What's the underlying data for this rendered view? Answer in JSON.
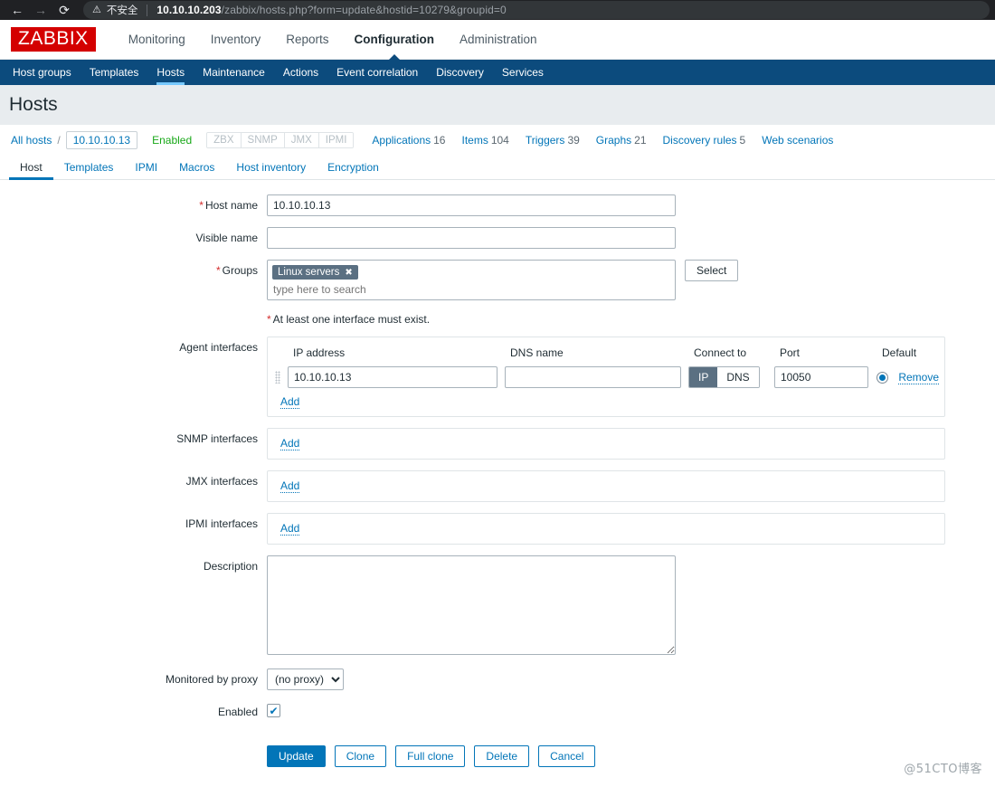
{
  "browser": {
    "back_icon": "arrow-left-icon",
    "forward_icon": "arrow-right-icon",
    "reload_icon": "reload-icon",
    "warning_icon": "warning-triangle-icon",
    "security_label": "不安全",
    "url_host": "10.10.10.203",
    "url_path": "/zabbix/hosts.php?form=update&hostid=10279&groupid=0"
  },
  "header": {
    "logo": "ZABBIX",
    "menu": [
      {
        "label": "Monitoring",
        "active": false
      },
      {
        "label": "Inventory",
        "active": false
      },
      {
        "label": "Reports",
        "active": false
      },
      {
        "label": "Configuration",
        "active": true
      },
      {
        "label": "Administration",
        "active": false
      }
    ]
  },
  "submenu": [
    {
      "label": "Host groups",
      "active": false
    },
    {
      "label": "Templates",
      "active": false
    },
    {
      "label": "Hosts",
      "active": true
    },
    {
      "label": "Maintenance",
      "active": false
    },
    {
      "label": "Actions",
      "active": false
    },
    {
      "label": "Event correlation",
      "active": false
    },
    {
      "label": "Discovery",
      "active": false
    },
    {
      "label": "Services",
      "active": false
    }
  ],
  "page": {
    "title": "Hosts"
  },
  "breadcrumb": {
    "all_hosts": "All hosts",
    "separator": "/",
    "current_host": "10.10.10.13",
    "status": "Enabled",
    "badges": [
      "ZBX",
      "SNMP",
      "JMX",
      "IPMI"
    ],
    "links": [
      {
        "label": "Applications",
        "count": "16"
      },
      {
        "label": "Items",
        "count": "104"
      },
      {
        "label": "Triggers",
        "count": "39"
      },
      {
        "label": "Graphs",
        "count": "21"
      },
      {
        "label": "Discovery rules",
        "count": "5"
      },
      {
        "label": "Web scenarios",
        "count": ""
      }
    ]
  },
  "tabs": [
    {
      "label": "Host",
      "active": true
    },
    {
      "label": "Templates",
      "active": false
    },
    {
      "label": "IPMI",
      "active": false
    },
    {
      "label": "Macros",
      "active": false
    },
    {
      "label": "Host inventory",
      "active": false
    },
    {
      "label": "Encryption",
      "active": false
    }
  ],
  "form": {
    "host_name": {
      "label": "Host name",
      "value": "10.10.10.13",
      "required": true
    },
    "visible_name": {
      "label": "Visible name",
      "value": "",
      "required": false
    },
    "groups": {
      "label": "Groups",
      "required": true,
      "chips": [
        "Linux servers"
      ],
      "chip_remove_icon": "close-icon",
      "placeholder": "type here to search",
      "select_button": "Select"
    },
    "interface_note": "At least one interface must exist.",
    "agent_interfaces": {
      "label": "Agent interfaces",
      "columns": [
        "IP address",
        "DNS name",
        "Connect to",
        "Port",
        "Default"
      ],
      "rows": [
        {
          "ip": "10.10.10.13",
          "dns": "",
          "connect_to": "IP",
          "connect_options": [
            "IP",
            "DNS"
          ],
          "port": "10050",
          "default_selected": true,
          "remove_label": "Remove"
        }
      ],
      "add_label": "Add"
    },
    "snmp_interfaces": {
      "label": "SNMP interfaces",
      "add_label": "Add"
    },
    "jmx_interfaces": {
      "label": "JMX interfaces",
      "add_label": "Add"
    },
    "ipmi_interfaces": {
      "label": "IPMI interfaces",
      "add_label": "Add"
    },
    "description": {
      "label": "Description",
      "value": ""
    },
    "monitored_by_proxy": {
      "label": "Monitored by proxy",
      "value": "(no proxy)",
      "options": [
        "(no proxy)"
      ]
    },
    "enabled": {
      "label": "Enabled",
      "checked": true,
      "check_icon": "check-icon"
    },
    "buttons": [
      {
        "label": "Update",
        "primary": true
      },
      {
        "label": "Clone",
        "primary": false
      },
      {
        "label": "Full clone",
        "primary": false
      },
      {
        "label": "Delete",
        "primary": false
      },
      {
        "label": "Cancel",
        "primary": false
      }
    ]
  },
  "watermark": "@51CTO博客"
}
